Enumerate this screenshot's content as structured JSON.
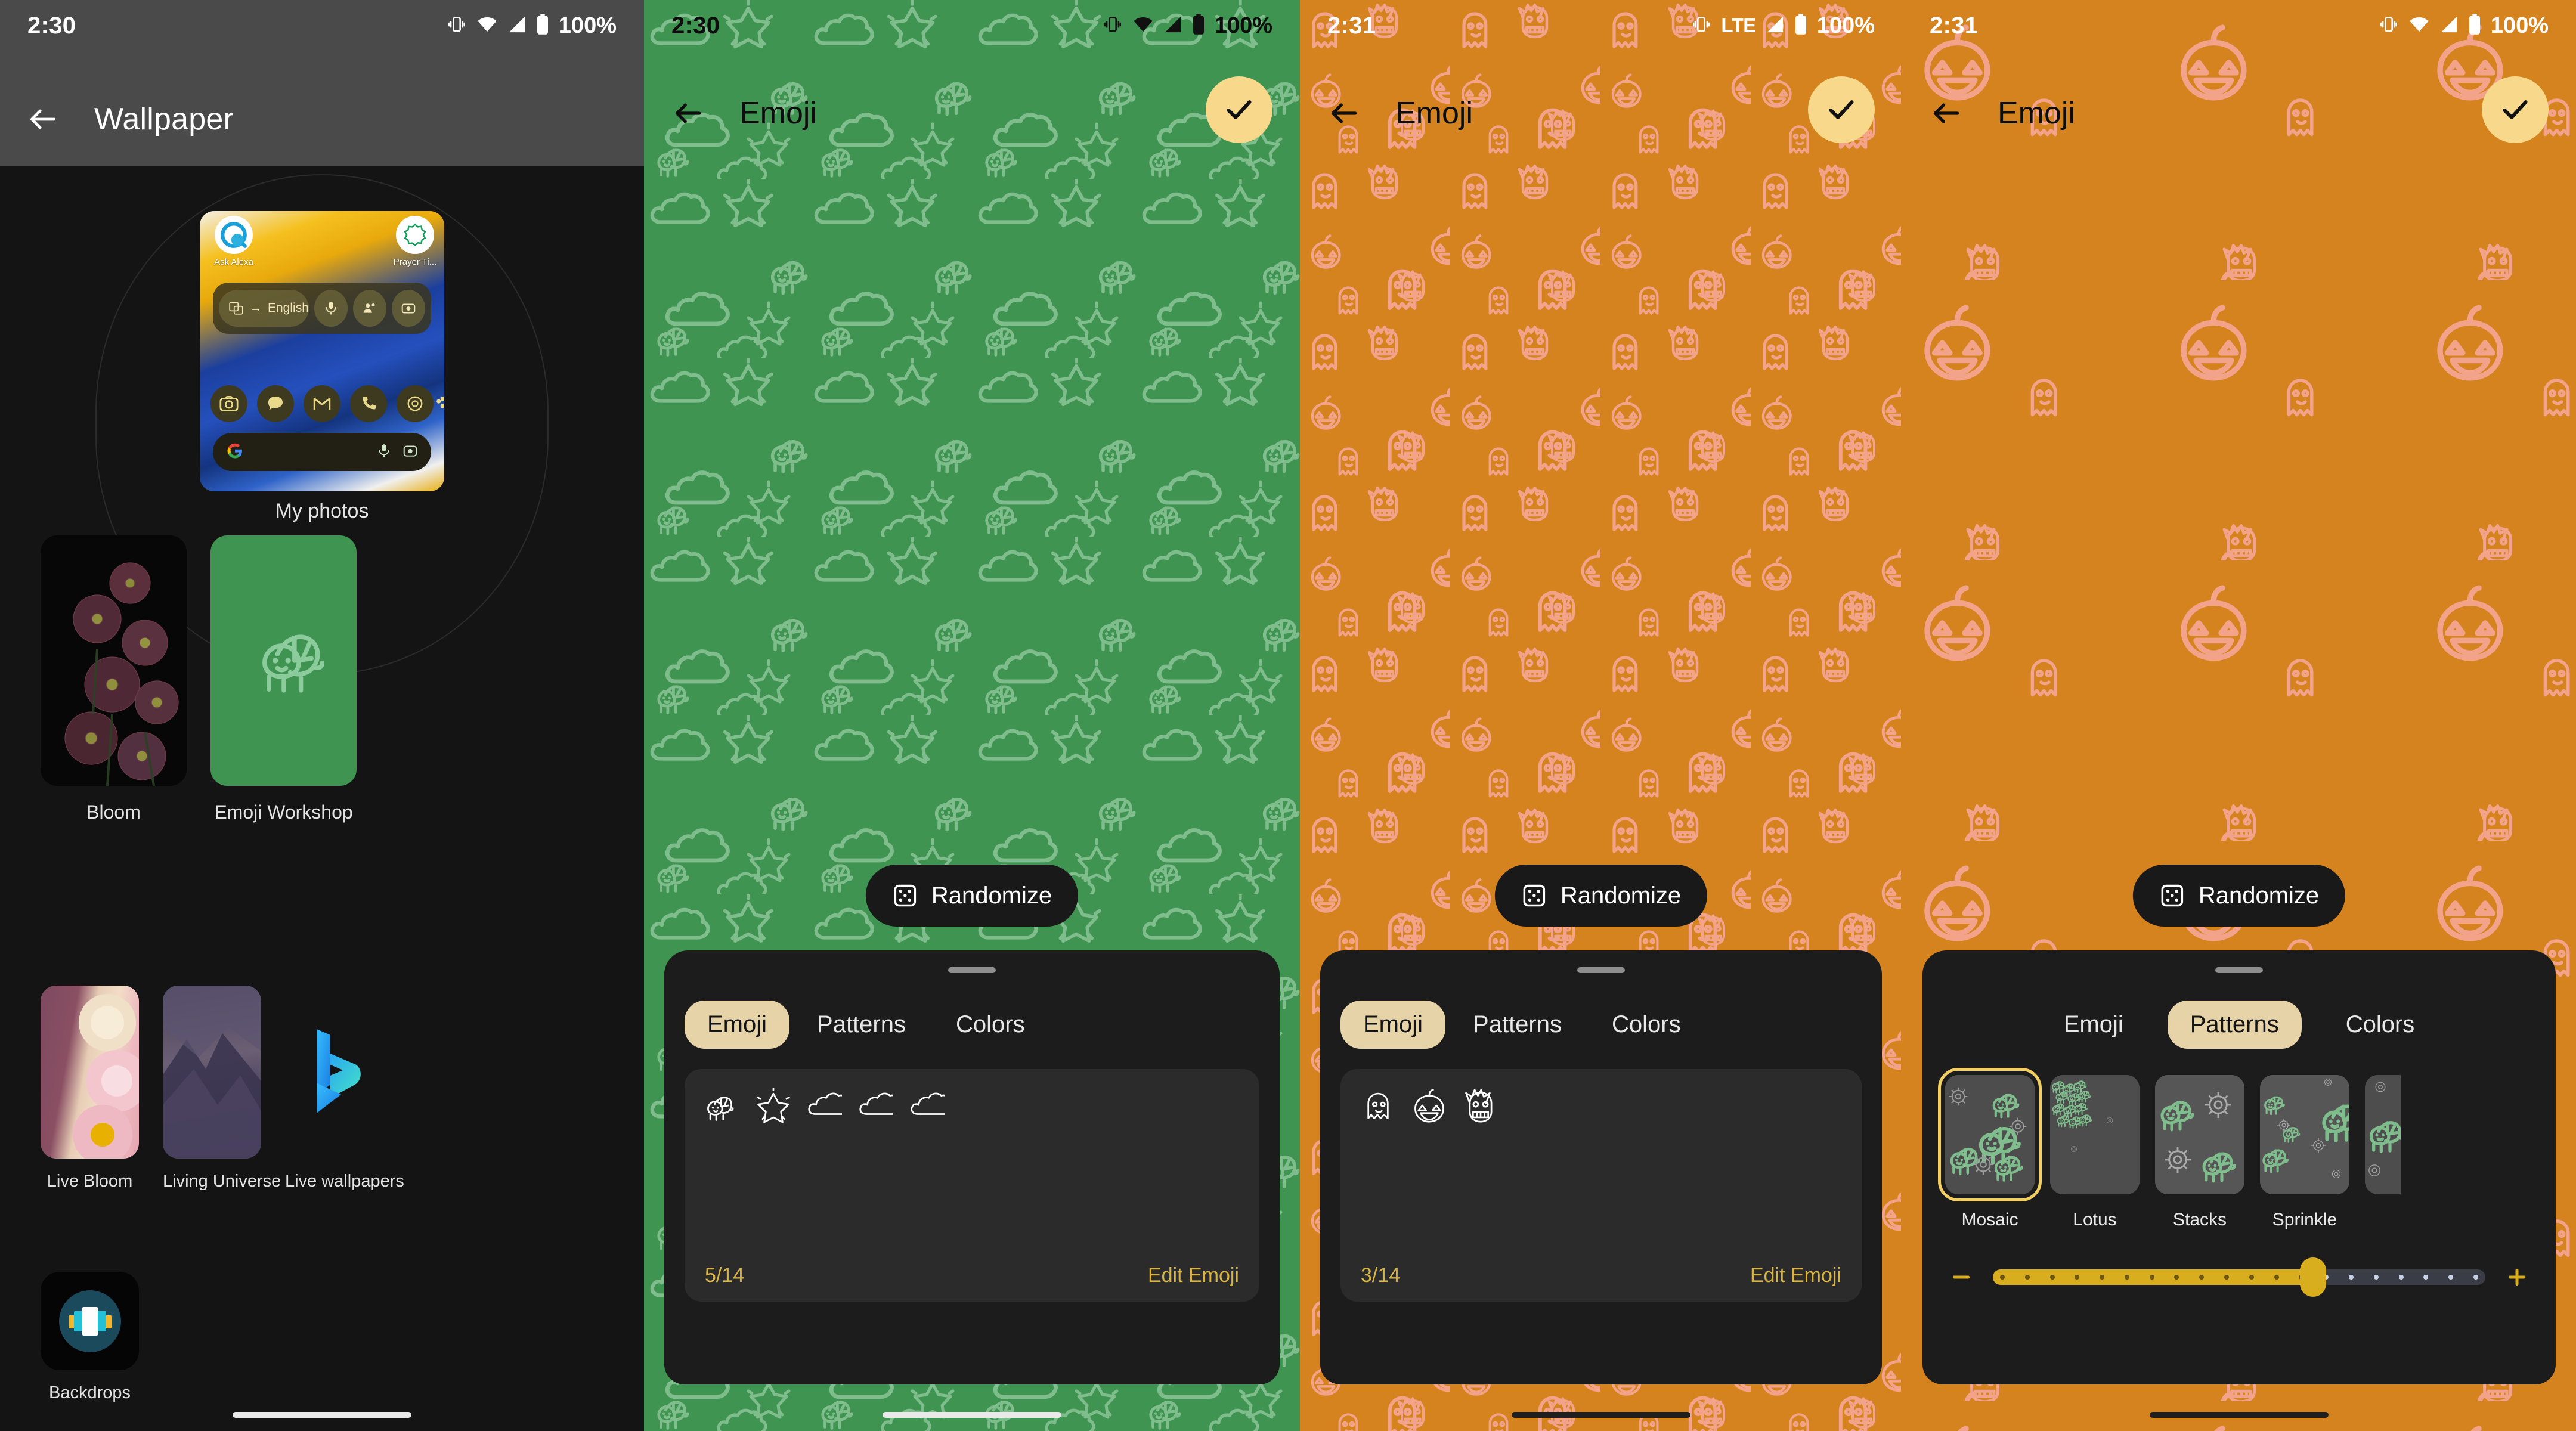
{
  "panel1": {
    "status": {
      "time": "2:30",
      "battery": "100%",
      "icons": [
        "vibrate-icon",
        "wifi-icon",
        "signal-icon",
        "battery-icon"
      ]
    },
    "title": "Wallpaper",
    "my_photos": {
      "label": "My photos",
      "preview_apps": [
        "Ask Alexa",
        "Prayer Ti..."
      ],
      "widget_language": "English"
    },
    "row1": [
      {
        "label": "Bloom",
        "kind": "photo-dark-flowers"
      },
      {
        "label": "Emoji Workshop",
        "kind": "turtle-green",
        "color": "#3f9451"
      }
    ],
    "row2": [
      {
        "label": "Live Bloom",
        "kind": "photo-pink-dahlia"
      },
      {
        "label": "Living Universe",
        "kind": "photo-cliff"
      },
      {
        "label": "Live wallpapers",
        "kind": "bing-logo"
      }
    ],
    "row3": [
      {
        "label": "Backdrops",
        "kind": "app-icon"
      }
    ]
  },
  "panel2": {
    "status": {
      "time": "2:30",
      "battery": "100%",
      "network": "wifi"
    },
    "title": "Emoji",
    "confirm_label": "check-icon",
    "randomize_label": "Randomize",
    "wallpaper_color": "#3f9451",
    "tabs": [
      {
        "label": "Emoji",
        "active": true
      },
      {
        "label": "Patterns",
        "active": false
      },
      {
        "label": "Colors",
        "active": false
      }
    ],
    "emojis": [
      "turtle",
      "sparkle-star",
      "cloud",
      "cloud",
      "cloud"
    ],
    "count": "5/14",
    "edit_label": "Edit Emoji"
  },
  "panel3": {
    "status": {
      "time": "2:31",
      "battery": "100%",
      "network": "LTE"
    },
    "title": "Emoji",
    "confirm_label": "check-icon",
    "randomize_label": "Randomize",
    "wallpaper_color": "#d4831f",
    "tabs": [
      {
        "label": "Emoji",
        "active": true
      },
      {
        "label": "Patterns",
        "active": false
      },
      {
        "label": "Colors",
        "active": false
      }
    ],
    "emojis": [
      "ghost",
      "jack-o-lantern",
      "ogre"
    ],
    "count": "3/14",
    "edit_label": "Edit Emoji"
  },
  "panel4": {
    "status": {
      "time": "2:31",
      "battery": "100%",
      "network": "wifi"
    },
    "title": "Emoji",
    "confirm_label": "check-icon",
    "randomize_label": "Randomize",
    "wallpaper_color": "#d4831f",
    "tabs": [
      {
        "label": "Emoji",
        "active": false
      },
      {
        "label": "Patterns",
        "active": true
      },
      {
        "label": "Colors",
        "active": false
      }
    ],
    "patterns": [
      {
        "label": "Mosaic",
        "selected": true
      },
      {
        "label": "Lotus",
        "selected": false
      },
      {
        "label": "Stacks",
        "selected": false
      },
      {
        "label": "Sprinkle",
        "selected": false
      }
    ],
    "slider": {
      "value_pct": 65,
      "minus": "−",
      "plus": "+"
    }
  },
  "colors": {
    "green_wallpaper": "#3f9451",
    "orange_wallpaper": "#d4831f",
    "salmon_motif": "#f0997f",
    "accent_gold": "#d8b545",
    "tab_active": "#e6d3a7",
    "fab_yellow": "#f8d88a",
    "sheet_bg": "#1c1c1c"
  }
}
